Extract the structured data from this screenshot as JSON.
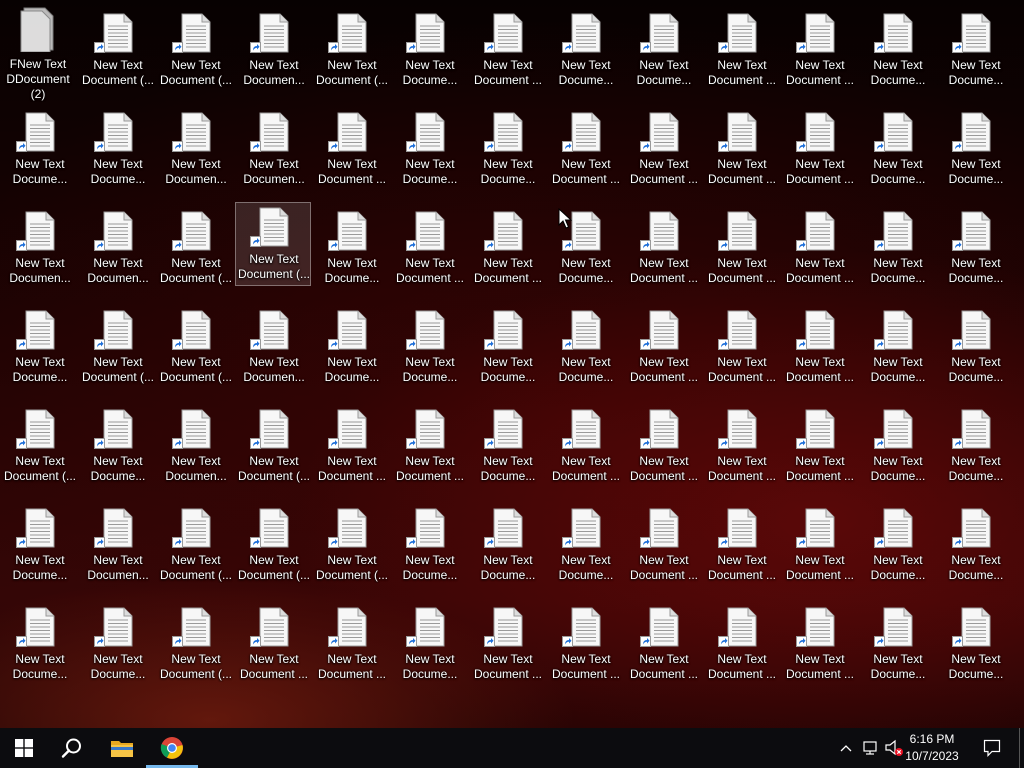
{
  "desktop": {
    "icon_name": "text-document-shortcut-icon",
    "overlap_label": "FNew Text\nDDocument (2)",
    "selected_index": 29,
    "icons": [
      "",
      "New Text\nDocument (...",
      "New Text\nDocument (...",
      "New Text\nDocumen...",
      "New Text\nDocument (...",
      "New Text\nDocume...",
      "New Text\nDocument ...",
      "New Text\nDocume...",
      "New Text\nDocume...",
      "New Text\nDocument ...",
      "New Text\nDocument ...",
      "New Text\nDocume...",
      "New Text\nDocume...",
      "New Text\nDocume...",
      "New Text\nDocume...",
      "New Text\nDocumen...",
      "New Text\nDocumen...",
      "New Text\nDocument ...",
      "New Text\nDocume...",
      "New Text\nDocume...",
      "New Text\nDocument ...",
      "New Text\nDocument ...",
      "New Text\nDocument ...",
      "New Text\nDocument ...",
      "New Text\nDocume...",
      "New Text\nDocume...",
      "New Text\nDocumen...",
      "New Text\nDocumen...",
      "New Text\nDocument (...",
      "New Text\nDocument (...",
      "New Text\nDocume...",
      "New Text\nDocument ...",
      "New Text\nDocument ...",
      "New Text\nDocume...",
      "New Text\nDocument ...",
      "New Text\nDocument ...",
      "New Text\nDocument ...",
      "New Text\nDocume...",
      "New Text\nDocume...",
      "New Text\nDocume...",
      "New Text\nDocument (...",
      "New Text\nDocument (...",
      "New Text\nDocumen...",
      "New Text\nDocume...",
      "New Text\nDocume...",
      "New Text\nDocume...",
      "New Text\nDocume...",
      "New Text\nDocument ...",
      "New Text\nDocument ...",
      "New Text\nDocument ...",
      "New Text\nDocume...",
      "New Text\nDocume...",
      "New Text\nDocument (...",
      "New Text\nDocume...",
      "New Text\nDocumen...",
      "New Text\nDocument (...",
      "New Text\nDocument ...",
      "New Text\nDocument ...",
      "New Text\nDocume...",
      "New Text\nDocument ...",
      "New Text\nDocument ...",
      "New Text\nDocument ...",
      "New Text\nDocument ...",
      "New Text\nDocume...",
      "New Text\nDocume...",
      "New Text\nDocume...",
      "New Text\nDocumen...",
      "New Text\nDocument (...",
      "New Text\nDocument (...",
      "New Text\nDocument (...",
      "New Text\nDocume...",
      "New Text\nDocume...",
      "New Text\nDocume...",
      "New Text\nDocument ...",
      "New Text\nDocument ...",
      "New Text\nDocument ...",
      "New Text\nDocume...",
      "New Text\nDocume...",
      "New Text\nDocume...",
      "New Text\nDocume...",
      "New Text\nDocument (...",
      "New Text\nDocument ...",
      "New Text\nDocument ...",
      "New Text\nDocume...",
      "New Text\nDocument ...",
      "New Text\nDocument ...",
      "New Text\nDocument ...",
      "New Text\nDocument ...",
      "New Text\nDocument ...",
      "New Text\nDocume...",
      "New Text\nDocume..."
    ]
  },
  "taskbar": {
    "start_icon": "windows-start-icon",
    "search_icon": "search-icon",
    "apps": [
      {
        "name": "file-explorer-icon"
      },
      {
        "name": "chrome-icon"
      }
    ],
    "tray": {
      "chevron_icon": "chevron-up-icon",
      "network_icon": "network-disconnected-icon",
      "volume_icon": "volume-muted-icon",
      "notification_icon": "action-center-icon"
    },
    "clock": {
      "time": "6:16 PM",
      "date": "10/7/2023"
    }
  },
  "colors": {
    "taskbar": "#0c0c0f",
    "selection": "#ffffff22",
    "shortcut_arrow": "#1e6fd9",
    "error_badge": "#e81123"
  }
}
